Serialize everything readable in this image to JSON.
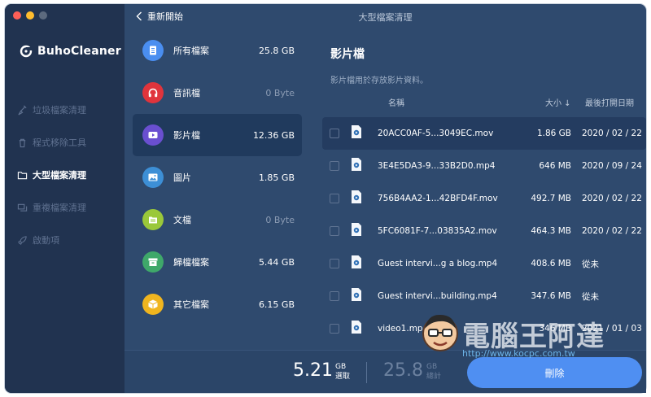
{
  "app": {
    "name": "BuhoCleaner",
    "window_title": "大型檔案清理",
    "back_label": "重新開始"
  },
  "sidebar": {
    "items": [
      {
        "label": "垃圾檔案清理",
        "icon": "broom-icon",
        "active": false
      },
      {
        "label": "程式移除工具",
        "icon": "trash-icon",
        "active": false
      },
      {
        "label": "大型檔案清理",
        "icon": "folder-icon",
        "active": true
      },
      {
        "label": "重複檔案清理",
        "icon": "duplicate-icon",
        "active": false
      },
      {
        "label": "啟動項",
        "icon": "rocket-icon",
        "active": false
      }
    ]
  },
  "categories": [
    {
      "name": "所有檔案",
      "size": "25.8 GB",
      "icon": "document-list-icon",
      "color": "#4a8ef0"
    },
    {
      "name": "音訊檔",
      "size": "0 Byte",
      "icon": "headphones-icon",
      "color": "#e0343c"
    },
    {
      "name": "影片檔",
      "size": "12.36 GB",
      "icon": "play-icon",
      "color": "#6a4fd0"
    },
    {
      "name": "圖片",
      "size": "1.85 GB",
      "icon": "image-icon",
      "color": "#3d8fd6"
    },
    {
      "name": "文檔",
      "size": "0 Byte",
      "icon": "document-icon",
      "color": "#9ac83a"
    },
    {
      "name": "歸檔檔案",
      "size": "5.44 GB",
      "icon": "archive-icon",
      "color": "#3fa86a"
    },
    {
      "name": "其它檔案",
      "size": "6.15 GB",
      "icon": "box-icon",
      "color": "#f0b51f"
    }
  ],
  "panel": {
    "title": "影片檔",
    "description": "影片檔用於存放影片資料。",
    "columns": {
      "name": "名稱",
      "size": "大小 ↓",
      "date": "最後打開日期"
    },
    "files": [
      {
        "name": "20ACC0AF-5...3049EC.mov",
        "size": "1.86 GB",
        "date": "2020 / 02 / 22"
      },
      {
        "name": "3E4E5DA3-9...33B2D0.mp4",
        "size": "646 MB",
        "date": "2020 / 09 / 24"
      },
      {
        "name": "756B4AA2-1...42BFD4F.mov",
        "size": "492.7 MB",
        "date": "2020 / 02 / 22"
      },
      {
        "name": "5FC6081F-7...03835A2.mov",
        "size": "464.3 MB",
        "date": "2020 / 02 / 22"
      },
      {
        "name": "Guest intervi...g a blog.mp4",
        "size": "408.6 MB",
        "date": "從未"
      },
      {
        "name": "Guest intervi...building.mp4",
        "size": "347.6 MB",
        "date": "從未"
      },
      {
        "name": "video1.mp4",
        "size": "346 MB",
        "date": "2021 / 01 / 03"
      }
    ]
  },
  "footer": {
    "selected_value": "5.21",
    "selected_unit": "GB",
    "selected_label": "選取",
    "total_value": "25.8",
    "total_unit": "GB",
    "total_label": "總計",
    "delete_label": "刪除"
  },
  "watermark": {
    "title": "電腦王阿達",
    "url": "http://www.kocpc.com.tw"
  }
}
